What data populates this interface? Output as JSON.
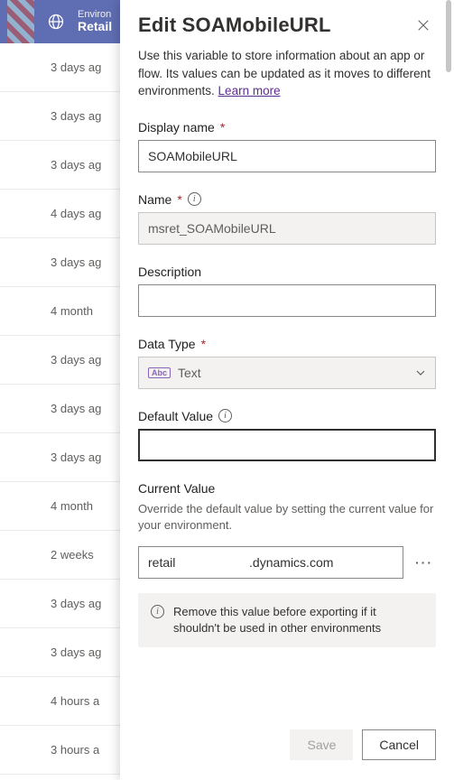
{
  "header": {
    "env_label": "Environ",
    "env_name": "Retail"
  },
  "bg_rows": [
    "3 days ag",
    "3 days ag",
    "3 days ag",
    "4 days ag",
    "3 days ag",
    "4 month",
    "3 days ag",
    "3 days ag",
    "3 days ag",
    "4 month",
    "2 weeks",
    "3 days ag",
    "3 days ag",
    "4 hours a",
    "3 hours a"
  ],
  "panel": {
    "title": "Edit SOAMobileURL",
    "description_prefix": "Use this variable to store information about an app or flow. Its values can be updated as it moves to different environments. ",
    "learn_more": "Learn more",
    "display_name_label": "Display name",
    "display_name_value": "SOAMobileURL",
    "name_label": "Name",
    "name_value": "msret_SOAMobileURL",
    "description_label": "Description",
    "description_value": "",
    "data_type_label": "Data Type",
    "data_type_value": "Text",
    "default_label": "Default Value",
    "default_value": "",
    "current_label": "Current Value",
    "current_sub": "Override the default value by setting the current value for your environment.",
    "current_value": "retail                     .dynamics.com",
    "warn_text": "Remove this value before exporting if it shouldn't be used in other environments",
    "save_label": "Save",
    "cancel_label": "Cancel"
  }
}
